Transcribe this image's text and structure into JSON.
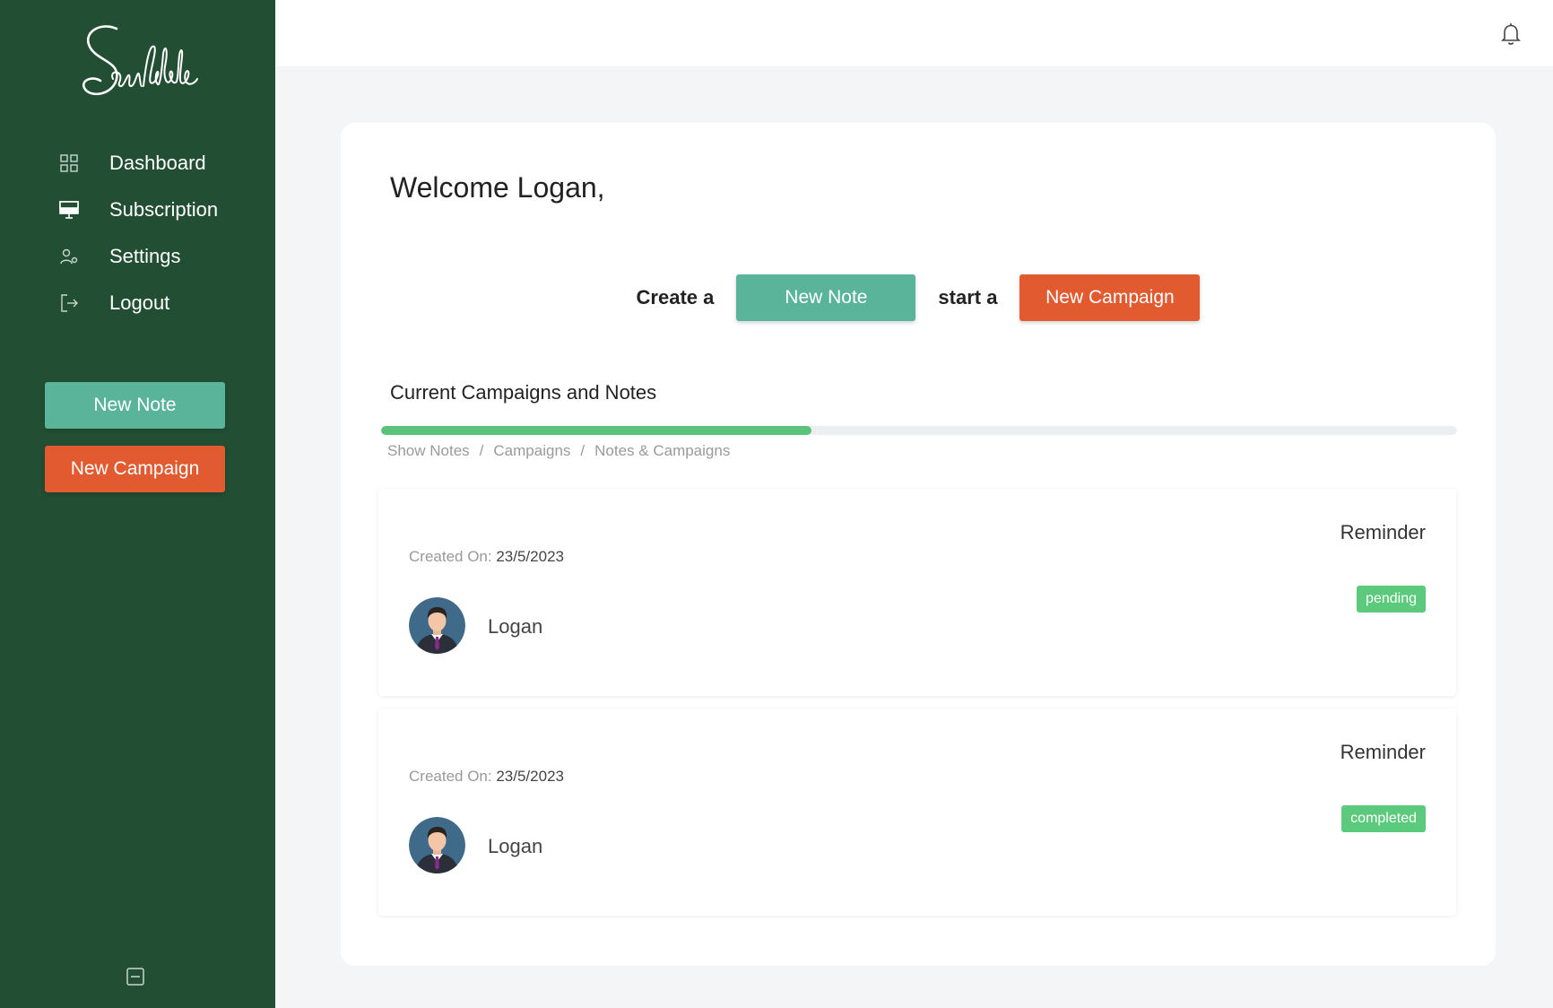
{
  "app": {
    "logo_text": "Scribble"
  },
  "sidebar": {
    "items": [
      {
        "label": "Dashboard",
        "icon": "dashboard-grid-icon"
      },
      {
        "label": "Subscription",
        "icon": "monitor-icon"
      },
      {
        "label": "Settings",
        "icon": "user-settings-icon"
      },
      {
        "label": "Logout",
        "icon": "logout-icon"
      }
    ],
    "new_note_label": "New Note",
    "new_campaign_label": "New Campaign",
    "collapse_icon": "collapse-icon"
  },
  "topbar": {
    "notification_icon": "bell-icon"
  },
  "main": {
    "welcome": "Welcome Logan,",
    "cta": {
      "create_text": "Create a",
      "new_note_label": "New Note",
      "start_text": "start a",
      "new_campaign_label": "New Campaign"
    },
    "section_title": "Current Campaigns and Notes",
    "progress_fraction": 0.4,
    "tabs": [
      {
        "label": "Show Notes"
      },
      {
        "label": "Campaigns"
      },
      {
        "label": "Notes & Campaigns"
      }
    ],
    "tab_separator": "/",
    "entries": [
      {
        "created_label": "Created On:",
        "date": "23/5/2023",
        "user": "Logan",
        "type": "Reminder",
        "status": "pending"
      },
      {
        "created_label": "Created On:",
        "date": "23/5/2023",
        "user": "Logan",
        "type": "Reminder",
        "status": "completed"
      }
    ]
  },
  "colors": {
    "sidebar_bg": "#224e33",
    "primary_green": "#5ab49a",
    "accent_orange": "#e25a30",
    "status_green": "#5bca7c"
  }
}
